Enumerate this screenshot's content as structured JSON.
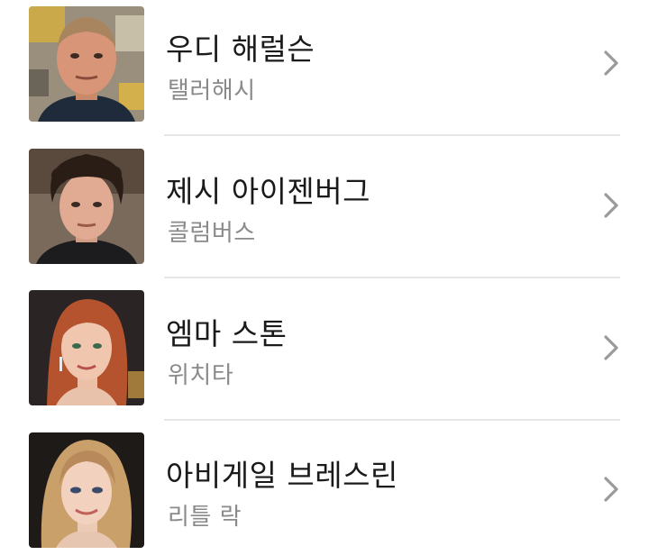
{
  "cast_list": {
    "items": [
      {
        "name": "우디 해럴슨",
        "role": "탤러해시"
      },
      {
        "name": "제시 아이젠버그",
        "role": "콜럼버스"
      },
      {
        "name": "엠마 스톤",
        "role": "위치타"
      },
      {
        "name": "아비게일 브레스린",
        "role": "리틀 락"
      }
    ]
  }
}
